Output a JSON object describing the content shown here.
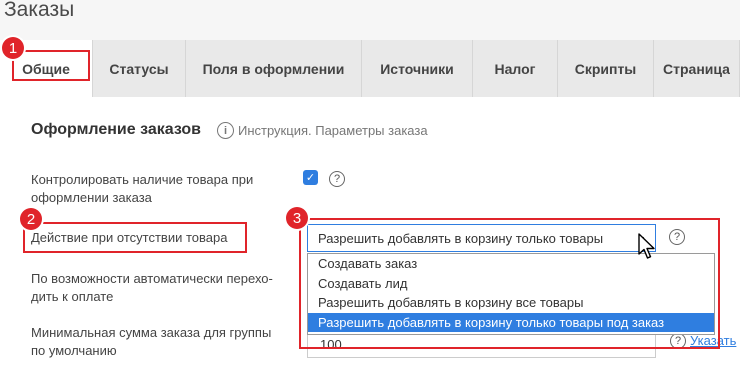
{
  "page": {
    "title": "Заказы"
  },
  "tabs": [
    {
      "label": "Общие",
      "active": true
    },
    {
      "label": "Статусы"
    },
    {
      "label": "Поля в оформлении"
    },
    {
      "label": "Источники"
    },
    {
      "label": "Налог"
    },
    {
      "label": "Скрипты"
    },
    {
      "label": "Страница"
    }
  ],
  "badges": {
    "b1": "1",
    "b2": "2",
    "b3": "3"
  },
  "section": {
    "title": "Оформление заказов",
    "instruction_link": "Инструкция. Параметры заказа"
  },
  "settings": {
    "check_stock_label": "Контролировать наличие товара при оформлении заказа",
    "check_stock_checked": true,
    "out_of_stock_label": "Действие при отсутствии товара",
    "out_of_stock_value": "Разрешить добавлять в корзину только товары под заказ",
    "out_of_stock_value_shown": "Разрешить добавлять в корзину только товары",
    "out_of_stock_options": [
      "Создавать заказ",
      "Создавать лид",
      "Разрешить добавлять в корзину все товары",
      "Разрешить добавлять в корзину только товары под заказ"
    ],
    "auto_payment_label": "По возможности автоматически переходить к оплате",
    "auto_payment_line1": "По возможности автоматически перехо-",
    "auto_payment_line2": "дить к оплате",
    "min_sum_label_line1": "Минимальная сумма заказа для группы",
    "min_sum_label_line2": "по умолчанию",
    "min_sum_value": "100",
    "show_link": "Указать"
  },
  "icons": {
    "question": "?",
    "info": "i",
    "check": "✓",
    "chevron": "⌄"
  },
  "colors": {
    "accent": "#2f7ee0",
    "highlight": "#e0242a"
  }
}
